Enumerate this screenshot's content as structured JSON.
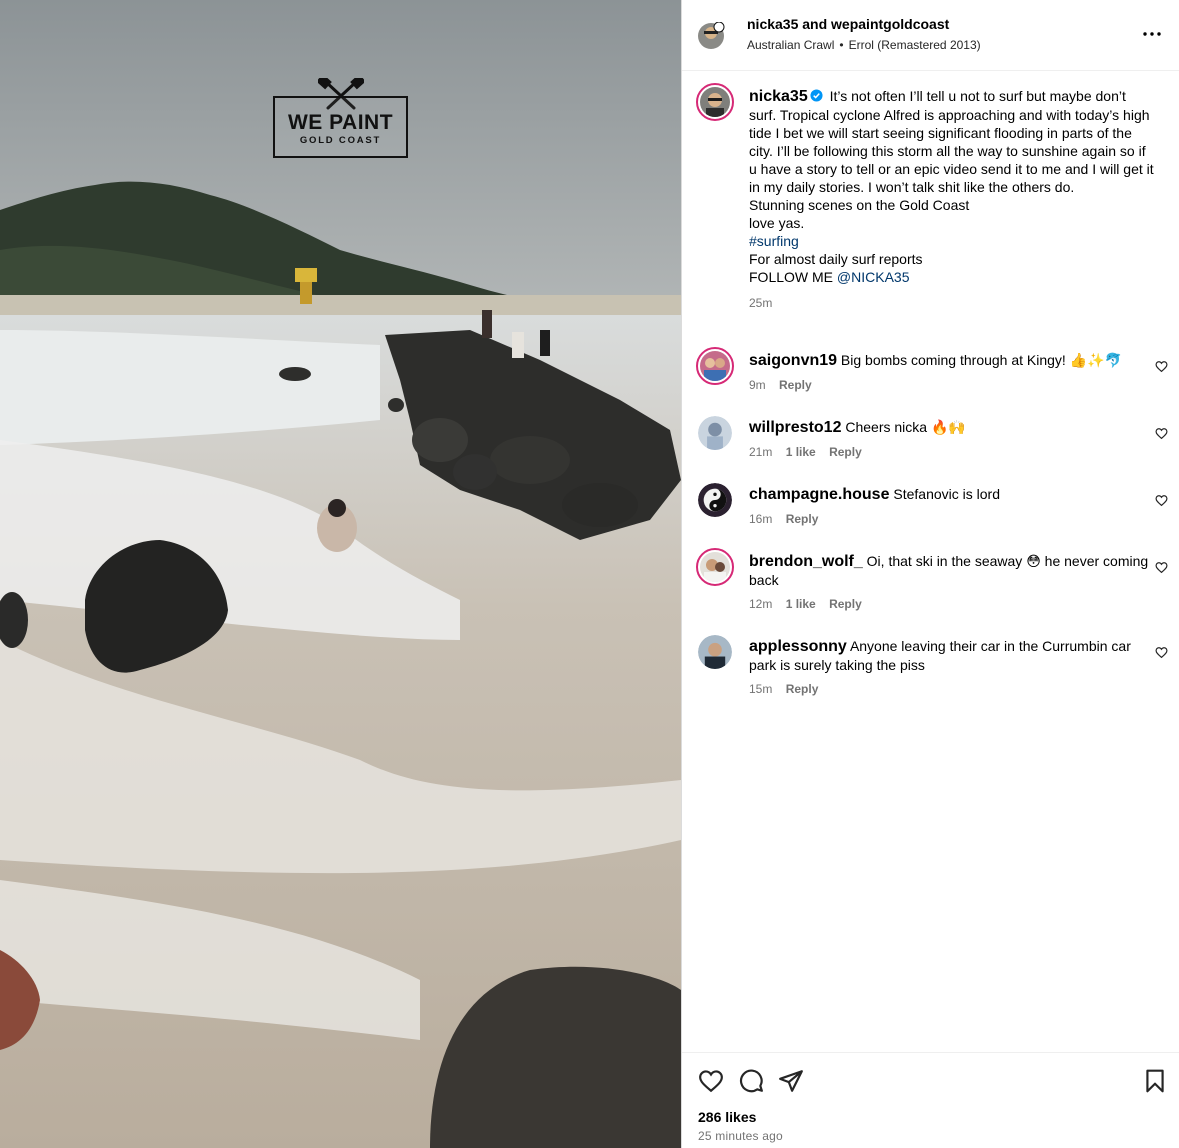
{
  "post": {
    "header": {
      "user_primary": "nicka35",
      "and_text": "and",
      "user_collab": "wepaintgoldcoast",
      "music_artist": "Australian Crawl",
      "music_sep": "•",
      "music_track": "Errol (Remastered 2013)",
      "more_icon": "more-horizontal-icon"
    },
    "media": {
      "watermark_line1": "WE PAINT",
      "watermark_line2": "GOLD COAST"
    },
    "caption": {
      "username": "nicka35",
      "verified": true,
      "line1": "It’s not often I’ll tell u not to surf but maybe don’t surf. Tropical cyclone Alfred is approaching and with today’s high tide I bet we will start seeing significant flooding in parts of the city. I’ll be following this storm all the way to sunshine again so if u have a story to tell or an epic video send it to me and I will get it in my daily stories. I won’t talk shit like the others do.",
      "line2": "Stunning scenes on the Gold Coast",
      "line3": "love yas.",
      "hashtag": "#surfing",
      "line4": "For almost daily surf reports",
      "follow_prefix": "FOLLOW ME",
      "mention": "@NICKA35",
      "time": "25m"
    },
    "comments": [
      {
        "username": "saigonvn19",
        "text": "Big bombs coming through at Kingy! 👍✨🐬",
        "time": "9m",
        "likes": "",
        "reply": "Reply"
      },
      {
        "username": "willpresto12",
        "text": "Cheers nicka 🔥🙌",
        "time": "21m",
        "likes": "1 like",
        "reply": "Reply"
      },
      {
        "username": "champagne.house",
        "text": "Stefanovic is lord",
        "time": "16m",
        "likes": "",
        "reply": "Reply"
      },
      {
        "username": "brendon_wolf_",
        "text": "Oi, that ski in the seaway 😳 he never coming back",
        "time": "12m",
        "likes": "1 like",
        "reply": "Reply"
      },
      {
        "username": "applessonny",
        "text": "Anyone leaving their car in the Currumbin car park is surely taking the piss",
        "time": "15m",
        "likes": "",
        "reply": "Reply"
      }
    ],
    "footer": {
      "likes": "286 likes",
      "posted": "25 minutes ago"
    }
  }
}
